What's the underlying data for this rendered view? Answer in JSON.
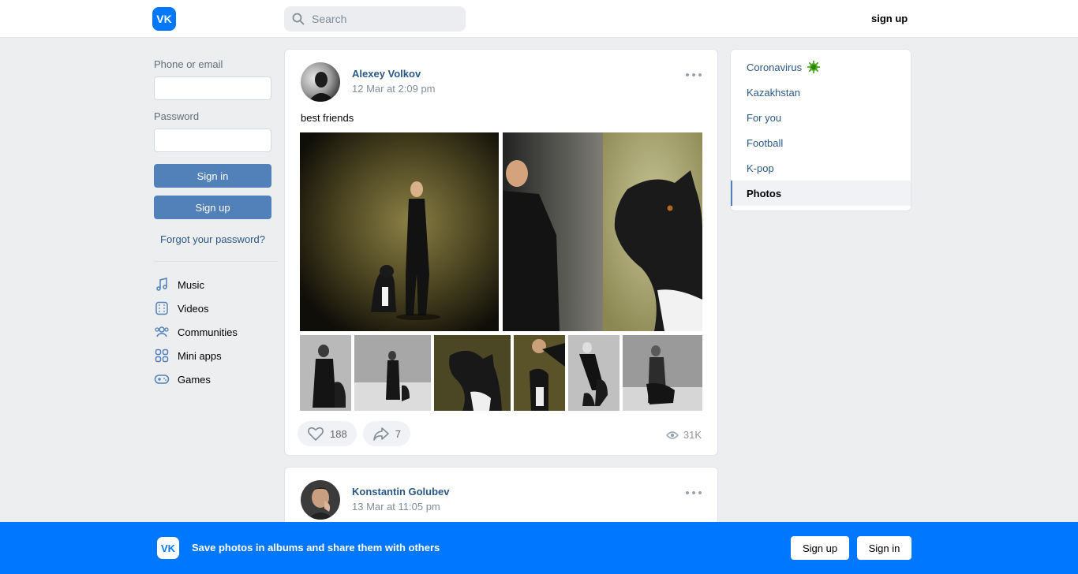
{
  "header": {
    "logo_text": "VK",
    "search_placeholder": "Search",
    "signup_link": "sign up"
  },
  "login": {
    "phone_label": "Phone or email",
    "phone_value": "",
    "password_label": "Password",
    "password_value": "",
    "sign_in": "Sign in",
    "sign_up": "Sign up",
    "forgot": "Forgot your password?"
  },
  "nav": {
    "items": [
      {
        "label": "Music",
        "icon": "music-icon"
      },
      {
        "label": "Videos",
        "icon": "videos-icon"
      },
      {
        "label": "Communities",
        "icon": "communities-icon"
      },
      {
        "label": "Mini apps",
        "icon": "mini-apps-icon"
      },
      {
        "label": "Games",
        "icon": "games-icon"
      }
    ]
  },
  "posts": [
    {
      "author": "Alexey Volkov",
      "date": "12 Mar at 2:09 pm",
      "text": "best friends",
      "likes": "188",
      "shares": "7",
      "views": "31K"
    },
    {
      "author": "Konstantin Golubev",
      "date": "13 Mar at 11:05 pm"
    }
  ],
  "topics": {
    "items": [
      {
        "label": "Coronavirus"
      },
      {
        "label": "Kazakhstan"
      },
      {
        "label": "For you"
      },
      {
        "label": "Football"
      },
      {
        "label": "K-pop"
      },
      {
        "label": "Photos"
      }
    ]
  },
  "banner": {
    "logo_text": "VK",
    "text": "Save photos in albums and share them with others",
    "sign_up": "Sign up",
    "sign_in": "Sign in"
  },
  "colors": {
    "brand": "#0077ff",
    "button": "#5181b8",
    "link": "#2a5885"
  }
}
